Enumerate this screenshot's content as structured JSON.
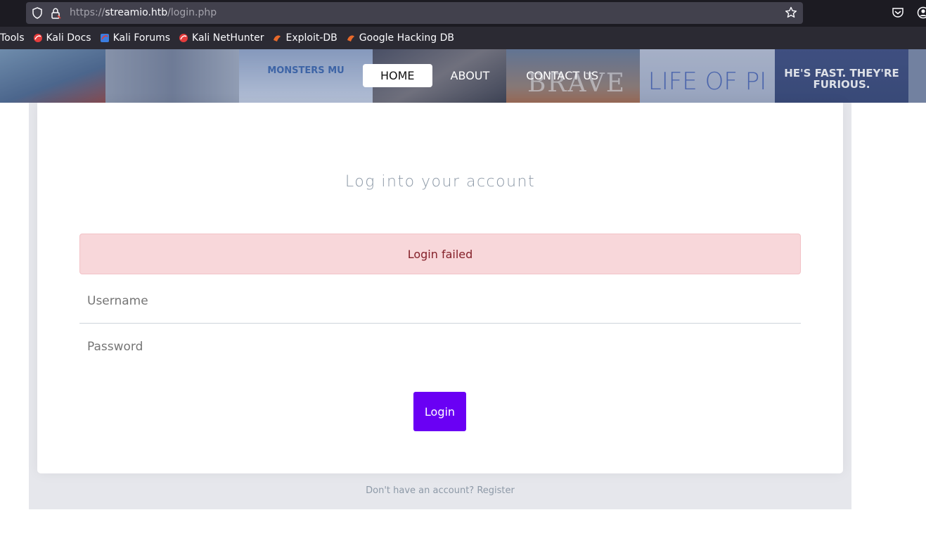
{
  "browser": {
    "url_scheme": "https://",
    "url_host": "streamio.htb",
    "url_path": "/login.php",
    "bookmarks": [
      {
        "label": "Tools",
        "icon": "none"
      },
      {
        "label": "Kali Docs",
        "icon": "kali-icon"
      },
      {
        "label": "Kali Forums",
        "icon": "kali-forums-icon"
      },
      {
        "label": "Kali NetHunter",
        "icon": "kali-icon"
      },
      {
        "label": "Exploit-DB",
        "icon": "exploit-db-icon"
      },
      {
        "label": "Google Hacking DB",
        "icon": "exploit-db-icon"
      }
    ]
  },
  "banner": {
    "posters": [
      {
        "text": ""
      },
      {
        "text": ""
      },
      {
        "text": "MONSTERS MU"
      },
      {
        "text": ""
      },
      {
        "text": "BRAVE"
      },
      {
        "text": "LIFE OF PI"
      },
      {
        "text": "HE'S FAST. THEY'RE FURIOUS."
      }
    ]
  },
  "nav": {
    "items": [
      {
        "label": "HOME",
        "active": true
      },
      {
        "label": "ABOUT",
        "active": false
      },
      {
        "label": "CONTACT US",
        "active": false
      }
    ]
  },
  "login": {
    "heading": "Log into your account",
    "alert": "Login failed",
    "username_placeholder": "Username",
    "password_placeholder": "Password",
    "button_label": "Login",
    "register_prompt": "Don't have an account?",
    "register_link": "Register"
  },
  "colors": {
    "accent": "#6a00f4",
    "alert_bg": "#f8d7da",
    "alert_text": "#842029"
  }
}
